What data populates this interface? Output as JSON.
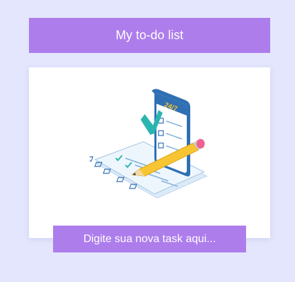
{
  "header": {
    "title": "My to-do list"
  },
  "illustration": {
    "name": "checklist-phone-illustration",
    "phone_label": "24/7"
  },
  "task_input": {
    "placeholder": "Digite sua nova task aqui...",
    "value": ""
  },
  "colors": {
    "background": "#e3e6fc",
    "accent": "#ad7dec",
    "card": "#ffffff",
    "phone": "#2f6fb3",
    "check": "#2bb5b0",
    "pencil": "#f7c531",
    "eraser": "#f06292"
  }
}
